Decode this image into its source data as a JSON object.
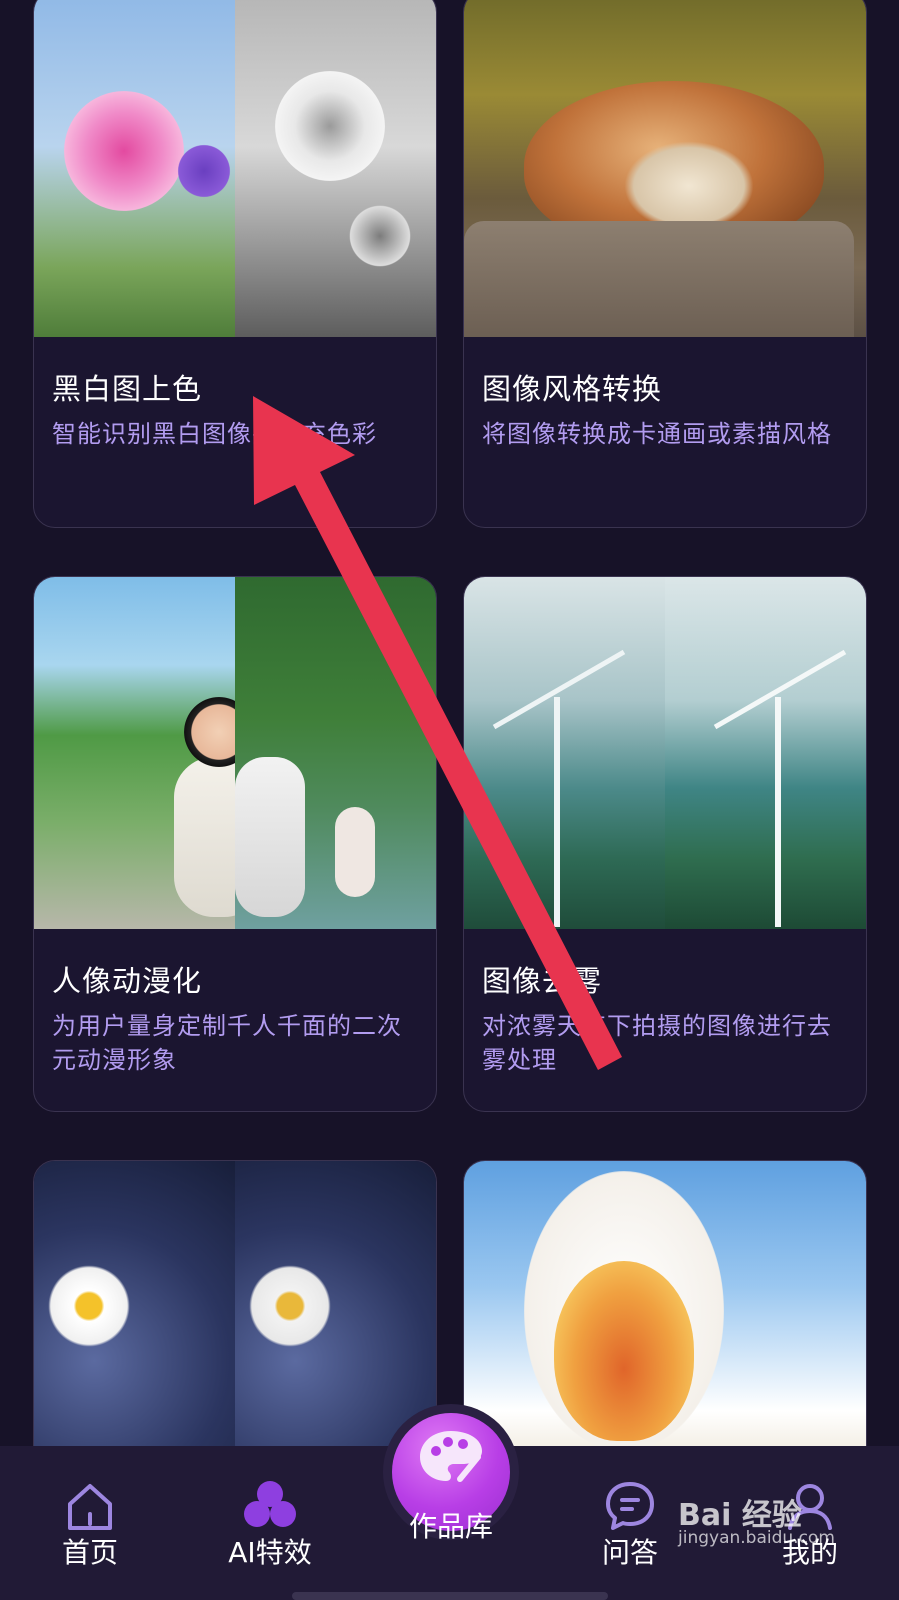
{
  "cards": [
    {
      "title": "黑白图上色",
      "desc": "智能识别黑白图像并填充色彩",
      "image": "flower-bw-compare"
    },
    {
      "title": "图像风格转换",
      "desc": "将图像转换成卡通画或素描风格",
      "image": "fox-sleeping"
    },
    {
      "title": "人像动漫化",
      "desc": "为用户量身定制千人千面的二次元动漫形象",
      "image": "girl-anime-compare"
    },
    {
      "title": "图像去雾",
      "desc": "对浓雾天气下拍摄的图像进行去雾处理",
      "image": "wind-turbine-compare"
    },
    {
      "title": "",
      "desc": "",
      "image": "blueberry-daisy-compare"
    },
    {
      "title": "",
      "desc": "",
      "image": "duck-photo"
    }
  ],
  "tabbar": {
    "home": {
      "label": "首页",
      "icon": "home-icon"
    },
    "ai": {
      "label": "AI特效",
      "icon": "ai-effects-icon"
    },
    "gallery": {
      "label": "作品库",
      "icon": "palette-icon"
    },
    "qa": {
      "label": "问答",
      "icon": "chat-icon"
    },
    "me": {
      "label": "我的",
      "icon": "profile-icon"
    }
  },
  "watermark": {
    "brand": "Bai 经验",
    "site": "jingyan.baidu.com"
  },
  "colors": {
    "background": "#171228",
    "accent": "#b83ee6",
    "desc_text": "#b29cf0",
    "annotation_arrow": "#e8344f"
  }
}
